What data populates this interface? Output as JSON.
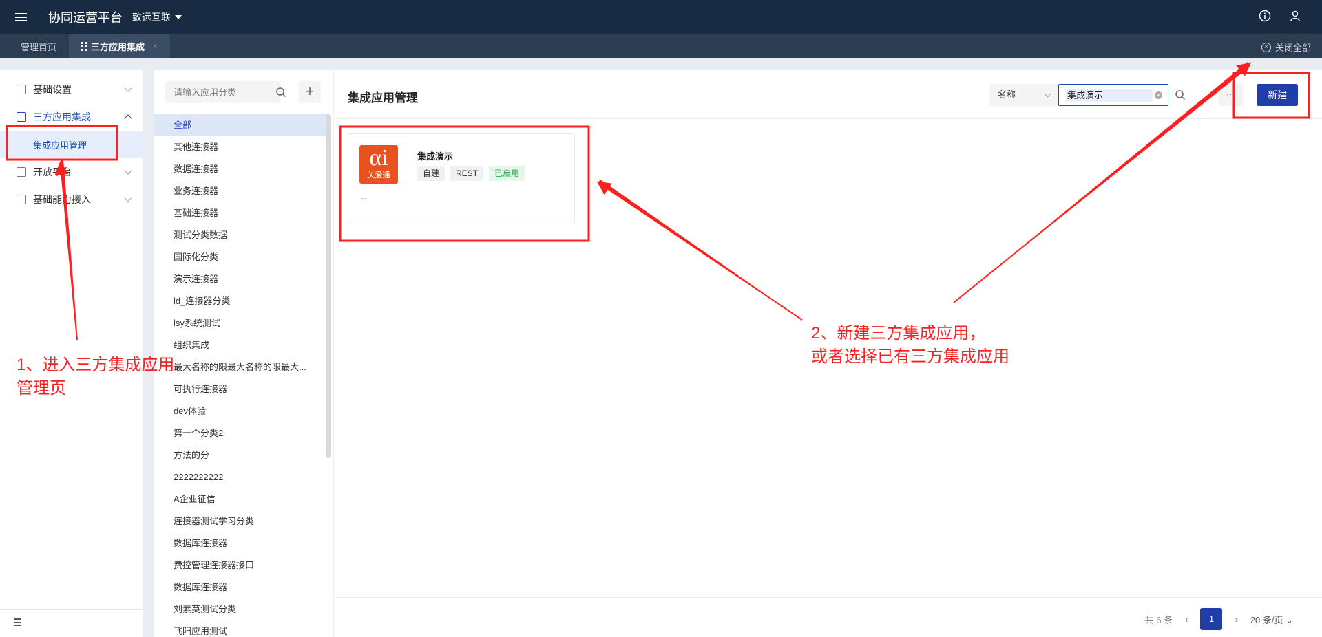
{
  "topbar": {
    "title": "协同运营平台",
    "org": "致远互联",
    "icons": [
      "menu-icon",
      "info-icon",
      "user-icon"
    ]
  },
  "tabs": [
    {
      "label": "管理首页"
    },
    {
      "label": "三方应用集成"
    }
  ],
  "tabbar": {
    "close_all": "关闭全部"
  },
  "sidebar": {
    "items": [
      {
        "label": "基础设置"
      },
      {
        "label": "三方应用集成"
      },
      {
        "label": "开放平台"
      },
      {
        "label": "基础能力接入"
      }
    ],
    "sub_item": "集成应用管理"
  },
  "categories": {
    "search_placeholder": "请输入应用分类",
    "items": [
      "全部",
      "其他连接器",
      "数据连接器",
      "业务连接器",
      "基础连接器",
      "测试分类数据",
      "国际化分类",
      "演示连接器",
      "ld_连接器分类",
      "lsy系统测试",
      "组织集成",
      "最大名称的限最大名称的限最大...",
      "可执行连接器",
      "dev体验",
      "第一个分类2",
      "方法的分",
      "2222222222",
      "A企业征信",
      "连接器测试学习分类",
      "数据库连接器",
      "费控管理连接器接口",
      "数据库连接器",
      "刘素英测试分类",
      "飞阳应用测试"
    ]
  },
  "main": {
    "title": "集成应用管理",
    "filter_field": "名称",
    "search_value": "集成演示",
    "more": "···",
    "new_button": "新建",
    "card": {
      "logo_text": "αi",
      "logo_subtext": "关爱通",
      "title": "集成演示",
      "tags": [
        "自建",
        "REST",
        "已启用"
      ],
      "description": "--"
    },
    "pager": {
      "total": "共 6 条",
      "current": "1",
      "page_size": "20 条/页"
    }
  },
  "annotations": {
    "note1": "1、进入三方集成应用\n管理页",
    "note2": "2、新建三方集成应用，\n或者选择已有三方集成应用",
    "color": "#ff1f1f"
  },
  "colors": {
    "topbar": "#192b43",
    "tabbar": "#2c3d52",
    "primary": "#1f3ea8",
    "logo": "#e8521f",
    "enabled_tag": "#2fa84f"
  }
}
